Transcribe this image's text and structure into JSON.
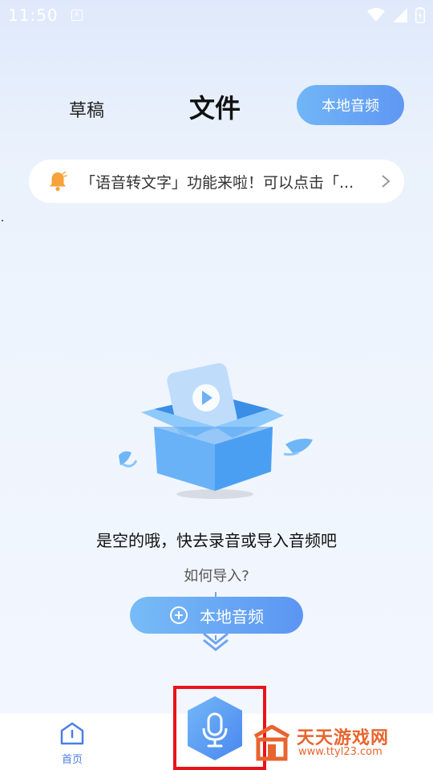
{
  "status_bar": {
    "time": "11:50",
    "notification_icon": "A"
  },
  "top_nav": {
    "draft_tab": "草稿",
    "files_tab": "文件",
    "local_audio_button": "本地音频"
  },
  "notice": {
    "icon": "bell-icon",
    "text": "「语音转文字」功能来啦！可以点击「..."
  },
  "empty_state": {
    "illustration": "open-box-with-video-icon",
    "message": "是空的哦，快去录音或导入音频吧",
    "how_to_import": "如何导入?",
    "local_audio_button": "本地音频"
  },
  "bottom_nav": {
    "home_label": "首页",
    "record_button_icon": "microphone-icon"
  },
  "watermark": {
    "title": "天天游戏网",
    "url": "www.ttyl23.com"
  },
  "colors": {
    "accent": "#5f97f3",
    "highlight": "#e8141a",
    "watermark": "#e8642e"
  }
}
